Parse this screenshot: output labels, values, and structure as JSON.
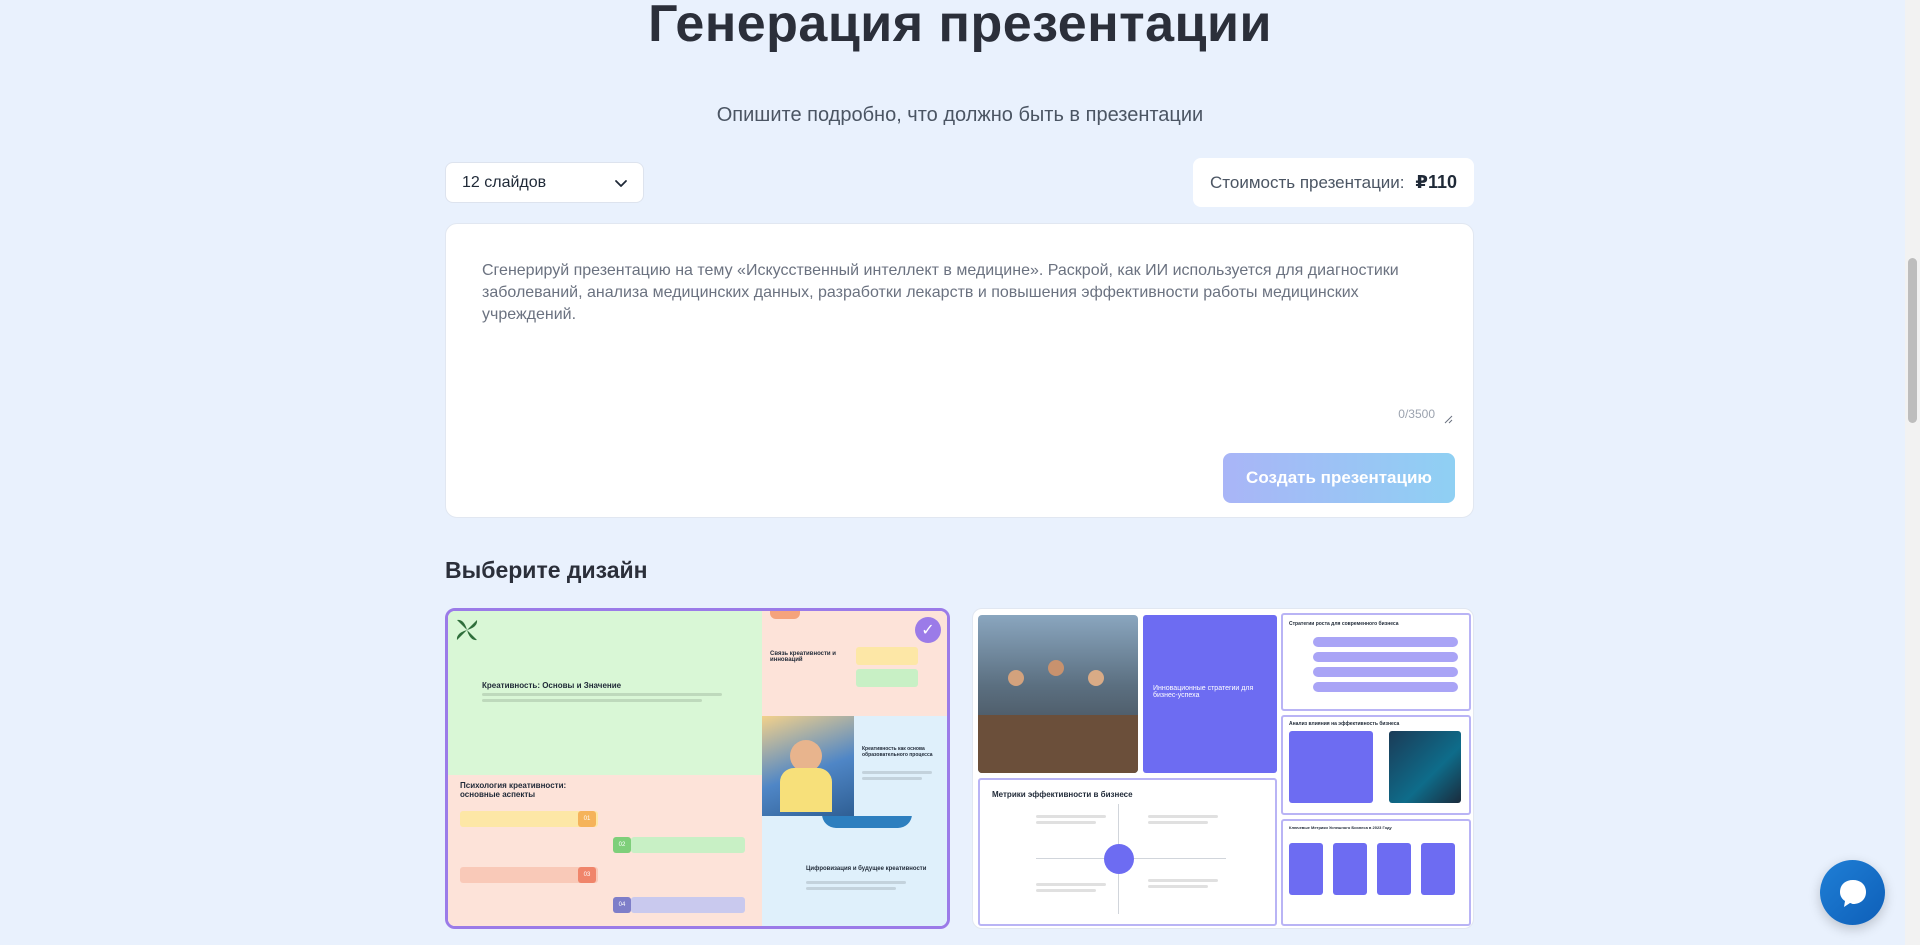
{
  "header": {
    "title": "Генерация презентации",
    "subtitle": "Опишите подробно, что должно быть в презентации"
  },
  "slides_select": {
    "value": "12 слайдов",
    "icon": "chevron-down-icon"
  },
  "cost": {
    "label": "Стоимость презентации:",
    "price": "₽110"
  },
  "prompt": {
    "placeholder": "Сгенерируй презентацию на тему «Искусственный интеллект в медицине». Раскрой, как ИИ используется для диагностики заболеваний, анализа медицинских данных, разработки лекарств и повышения эффективности работы медицинских учреждений.",
    "counter": "0/3500",
    "create_button": "Создать презентацию"
  },
  "design_section": {
    "heading": "Выберите дизайн",
    "check_mark": "✓",
    "designs": [
      {
        "selected": true,
        "slide_titles": {
          "main": "Креативность: Основы и Значение",
          "psychology": "Психология креативности: основные аспекты",
          "innovation": "Связь креативности и инноваций",
          "education": "Креативность как основа образовательного процесса",
          "future": "Цифровизация и будущее креативности"
        },
        "step_numbers": [
          "01",
          "02",
          "03",
          "04"
        ]
      },
      {
        "selected": false,
        "slide_titles": {
          "cover": "Инновационные стратегии для бизнес-успеха",
          "strategies": "Стратегии роста для современного бизнеса",
          "analysis": "Анализ влияния на эффективность бизнеса",
          "metrics": "Метрики эффективности в бизнесе",
          "key_metrics": "Ключевые Метрики Успешного Бизнеса в 2023 Году"
        }
      }
    ]
  },
  "chat": {
    "icon": "chat-bubble-icon"
  },
  "colors": {
    "background": "#e9f1fd",
    "accent": "#9b7be8",
    "button_gradient_start": "#a9b5f7",
    "button_gradient_end": "#8fd0f3",
    "chat": "#1f7fd6"
  }
}
